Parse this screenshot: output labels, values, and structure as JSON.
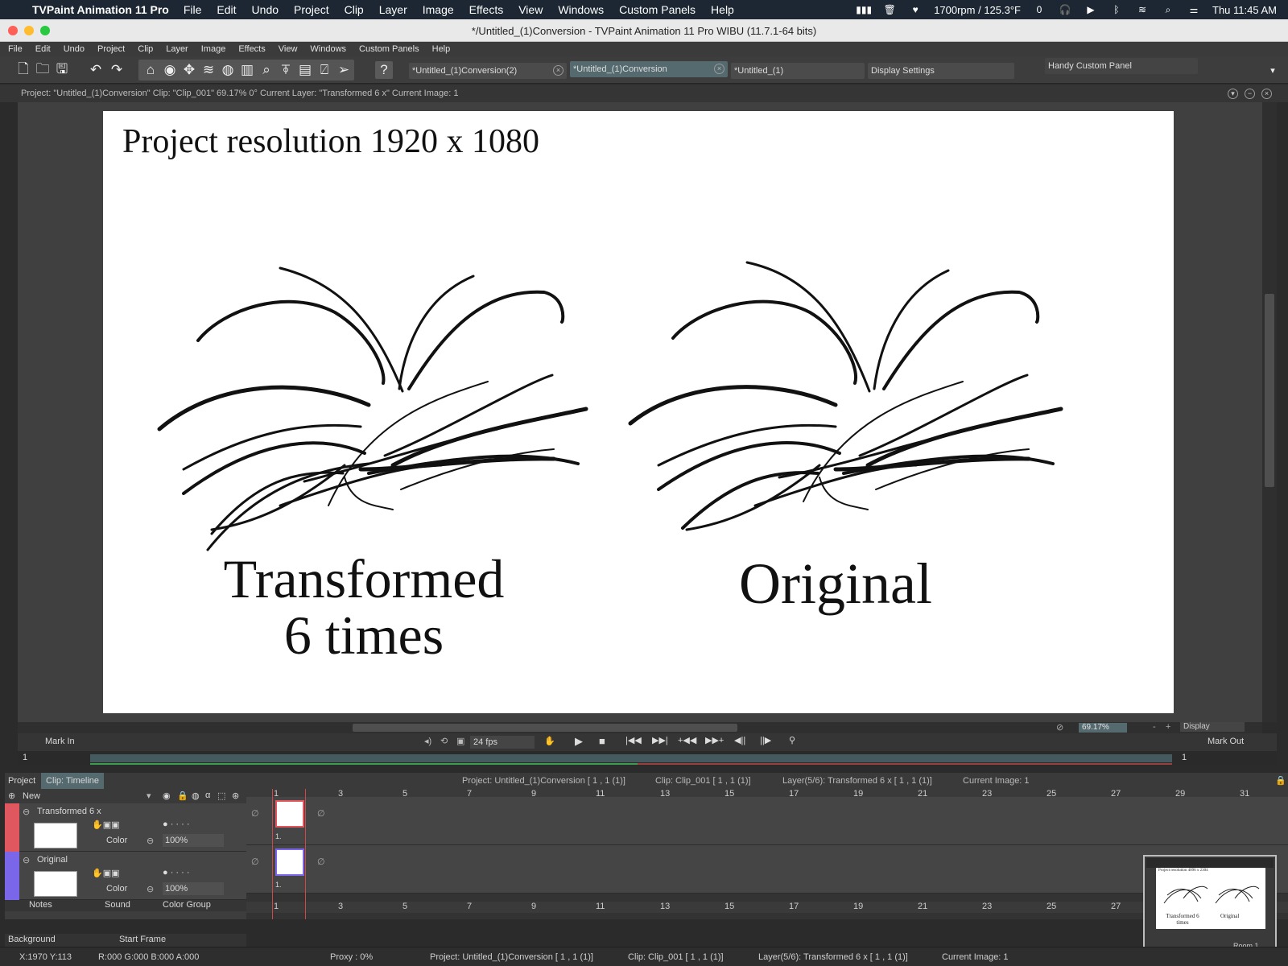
{
  "menubar": {
    "app_name": "TVPaint Animation 11 Pro",
    "items": [
      "File",
      "Edit",
      "Undo",
      "Project",
      "Clip",
      "Layer",
      "Image",
      "Effects",
      "View",
      "Windows",
      "Custom Panels",
      "Help"
    ],
    "status_fan": "1700rpm / 125.3°F",
    "clock": "Thu  11:45 AM"
  },
  "window": {
    "title": "*/Untitled_(1)Conversion - TVPaint Animation 11 Pro WIBU (11.7.1-64 bits)"
  },
  "app_menu": [
    "File",
    "Edit",
    "Undo",
    "Project",
    "Clip",
    "Layer",
    "Image",
    "Effects",
    "View",
    "Windows",
    "Custom Panels",
    "Help"
  ],
  "tabs": [
    {
      "label": "*Untitled_(1)Conversion(2)",
      "active": false
    },
    {
      "label": "*Untitled_(1)Conversion",
      "active": true
    },
    {
      "label": "*Untitled_(1)",
      "active": false
    }
  ],
  "display_settings_label": "Display Settings",
  "handy_panel_label": "Handy Custom Panel",
  "infobar": "Project: \"Untitled_(1)Conversion\"  Clip: \"Clip_001\"  69.17%   0°   Current Layer: \"Transformed 6 x\"   Current Image: 1",
  "canvas": {
    "heading": "Project resolution 1920 x 1080",
    "left_caption_line1": "Transformed",
    "left_caption_line2": "6 times",
    "right_caption": "Original"
  },
  "view": {
    "zoom": "69.17%",
    "display_label": "Display",
    "zoom_minus": "-",
    "zoom_plus": "+"
  },
  "transport": {
    "mark_in": "Mark In",
    "mark_out": "Mark Out",
    "fps": "24 fps",
    "start_value": "1",
    "end_value": "1"
  },
  "timeline": {
    "tab_project": "Project",
    "tab_clip": "Clip: Timeline",
    "info_project": "Project: Untitled_(1)Conversion [ 1 , 1  (1)]",
    "info_clip": "Clip: Clip_001 [ 1 , 1  (1)]",
    "info_layer": "Layer(5/6): Transformed 6 x [ 1 , 1  (1)]",
    "info_image": "Current Image: 1",
    "new_label": "New",
    "frame_numbers": [
      "1",
      "3",
      "5",
      "7",
      "9",
      "11",
      "13",
      "15",
      "17",
      "19",
      "21",
      "23",
      "25",
      "27",
      "29",
      "31"
    ],
    "frame_numbers_bottom": [
      "1",
      "3",
      "5",
      "7",
      "9",
      "11",
      "13",
      "15",
      "17",
      "19",
      "21",
      "23",
      "25",
      "27"
    ],
    "layers": [
      {
        "name": "Transformed 6 x",
        "blend": "Color",
        "opacity": "100%",
        "color": "#e0575f",
        "frame_label": "1."
      },
      {
        "name": "Original",
        "blend": "Color",
        "opacity": "100%",
        "color": "#7a66e8",
        "frame_label": "1."
      }
    ],
    "footer_buttons": [
      "Notes",
      "Sound",
      "Color Group"
    ],
    "background_label": "Background",
    "start_frame_label": "Start Frame"
  },
  "statusbar": {
    "coords": "X:1970  Y:113",
    "rgba": "R:000 G:000 B:000 A:000",
    "proxy": "Proxy : 0%",
    "project": "Project: Untitled_(1)Conversion [ 1 , 1  (1)]",
    "clip": "Clip: Clip_001 [ 1 , 1  (1)]",
    "layer": "Layer(5/6): Transformed 6 x [ 1 , 1  (1)]",
    "image": "Current Image: 1",
    "room": "Room 1"
  },
  "navigator": {
    "caption_left": "Transformed 6 times",
    "caption_right": "Original",
    "mini_heading": "Project resolution 4096 x 2304"
  }
}
